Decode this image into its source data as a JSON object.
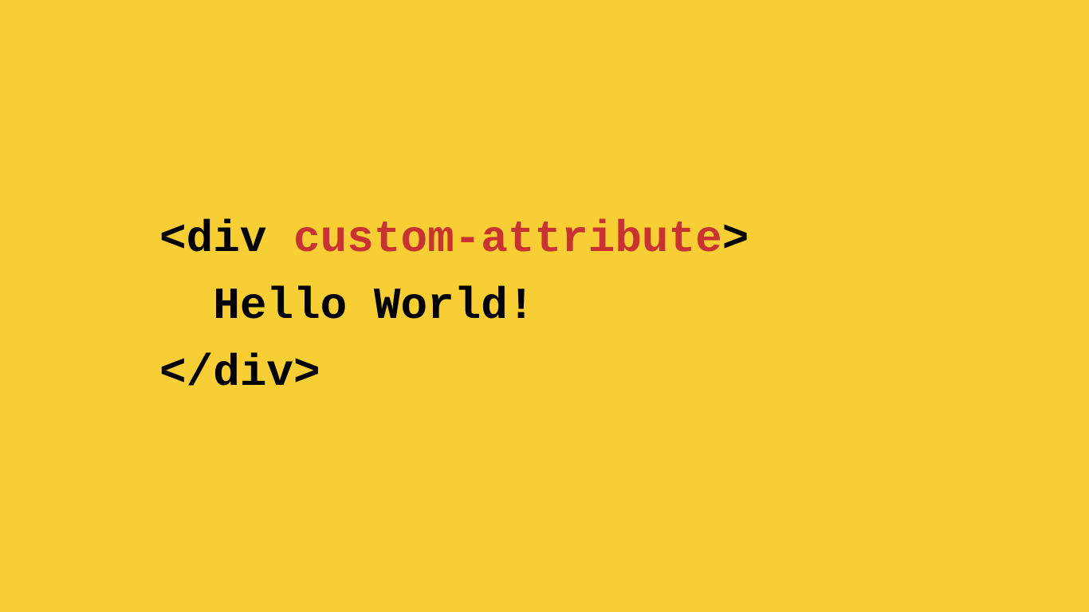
{
  "code": {
    "line1": {
      "open_bracket": "<",
      "tag": "div",
      "space": " ",
      "attribute": "custom-attribute",
      "close_bracket": ">"
    },
    "line2": {
      "indent": "  ",
      "content": "Hello World!"
    },
    "line3": {
      "close_tag": "</div>"
    }
  },
  "colors": {
    "background": "#f7ce33",
    "text": "#000000",
    "highlight": "#c83232"
  }
}
